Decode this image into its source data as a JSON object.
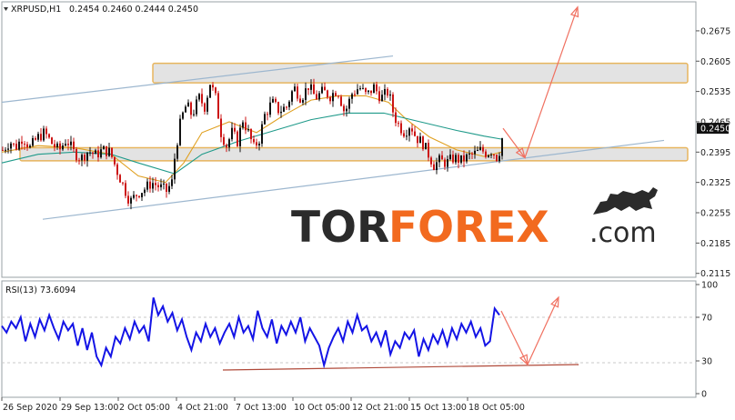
{
  "header": {
    "symbol_label": "XRPUSD,H1",
    "ohlc": "0.2454 0.2460 0.2444 0.2450"
  },
  "rsi_header": "RSI(13) 73.6094",
  "watermark": {
    "tor": "TOR",
    "forex": "FOREX",
    "dotcom": ".com"
  },
  "colors": {
    "candle_up": "#111111",
    "candle_down": "#cc1414",
    "ma_fast": "#e0a020",
    "ma_slow": "#1f9a8a",
    "channel": "#9db7cf",
    "zone_fill": "#d9d9d9",
    "zone_border": "#e8b55e",
    "arrow": "#f07060",
    "rsi_line": "#1414e6",
    "rsi_trend": "#b04a3a",
    "wm_dark": "#2b2b2b",
    "wm_orange": "#f26a1f",
    "price_tag_bg": "#111111"
  },
  "chart_data": [
    {
      "type": "candlestick",
      "title": "XRPUSD,H1",
      "price_labels": [
        "0.2675",
        "0.2605",
        "0.2535",
        "0.2465",
        "0.2450",
        "0.2395",
        "0.2325",
        "0.2255",
        "0.2185",
        "0.2115"
      ],
      "current_price": "0.2450",
      "ylim": [
        0.2106,
        0.2742
      ],
      "x_tick_labels": [
        "26 Sep 2020",
        "29 Sep 13:00",
        "2 Oct 05:00",
        "4 Oct 21:00",
        "7 Oct 13:00",
        "10 Oct 05:00",
        "12 Oct 21:00",
        "15 Oct 13:00",
        "18 Oct 05:00"
      ],
      "price_path": [
        [
          0,
          0.24
        ],
        [
          8,
          0.242
        ],
        [
          14,
          0.2405
        ],
        [
          22,
          0.243
        ],
        [
          30,
          0.2405
        ],
        [
          38,
          0.2428
        ],
        [
          46,
          0.244
        ],
        [
          54,
          0.2415
        ],
        [
          62,
          0.2398
        ],
        [
          70,
          0.2425
        ],
        [
          78,
          0.2395
        ],
        [
          86,
          0.238
        ],
        [
          94,
          0.2398
        ],
        [
          102,
          0.2388
        ],
        [
          110,
          0.24
        ],
        [
          118,
          0.2395
        ],
        [
          126,
          0.235
        ],
        [
          134,
          0.231
        ],
        [
          140,
          0.228
        ],
        [
          148,
          0.23
        ],
        [
          156,
          0.231
        ],
        [
          164,
          0.2325
        ],
        [
          172,
          0.2315
        ],
        [
          180,
          0.2305
        ],
        [
          186,
          0.2325
        ],
        [
          190,
          0.24
        ],
        [
          196,
          0.247
        ],
        [
          202,
          0.2505
        ],
        [
          208,
          0.248
        ],
        [
          216,
          0.252
        ],
        [
          222,
          0.25
        ],
        [
          228,
          0.2555
        ],
        [
          234,
          0.252
        ],
        [
          240,
          0.244
        ],
        [
          246,
          0.241
        ],
        [
          252,
          0.244
        ],
        [
          258,
          0.242
        ],
        [
          264,
          0.247
        ],
        [
          270,
          0.244
        ],
        [
          276,
          0.2405
        ],
        [
          282,
          0.2425
        ],
        [
          288,
          0.248
        ],
        [
          296,
          0.251
        ],
        [
          304,
          0.249
        ],
        [
          312,
          0.25
        ],
        [
          320,
          0.2545
        ],
        [
          328,
          0.252
        ],
        [
          336,
          0.2548
        ],
        [
          344,
          0.252
        ],
        [
          352,
          0.2535
        ],
        [
          360,
          0.2525
        ],
        [
          368,
          0.254
        ],
        [
          376,
          0.2485
        ],
        [
          384,
          0.253
        ],
        [
          392,
          0.2545
        ],
        [
          400,
          0.2525
        ],
        [
          408,
          0.2545
        ],
        [
          416,
          0.252
        ],
        [
          424,
          0.2535
        ],
        [
          430,
          0.248
        ],
        [
          436,
          0.2455
        ],
        [
          442,
          0.244
        ],
        [
          448,
          0.246
        ],
        [
          454,
          0.243
        ],
        [
          462,
          0.2415
        ],
        [
          468,
          0.239
        ],
        [
          474,
          0.2365
        ],
        [
          480,
          0.2375
        ],
        [
          488,
          0.237
        ],
        [
          496,
          0.2382
        ],
        [
          504,
          0.2375
        ],
        [
          512,
          0.2385
        ],
        [
          520,
          0.2392
        ],
        [
          526,
          0.24
        ],
        [
          532,
          0.2392
        ],
        [
          538,
          0.24
        ],
        [
          544,
          0.238
        ],
        [
          548,
          0.2415
        ],
        [
          551,
          0.245
        ]
      ],
      "ma_fast": [
        [
          0,
          0.2395
        ],
        [
          40,
          0.241
        ],
        [
          80,
          0.2405
        ],
        [
          120,
          0.239
        ],
        [
          150,
          0.234
        ],
        [
          180,
          0.2325
        ],
        [
          200,
          0.237
        ],
        [
          220,
          0.244
        ],
        [
          250,
          0.2465
        ],
        [
          280,
          0.244
        ],
        [
          310,
          0.248
        ],
        [
          340,
          0.2515
        ],
        [
          370,
          0.2525
        ],
        [
          400,
          0.2525
        ],
        [
          425,
          0.251
        ],
        [
          445,
          0.247
        ],
        [
          470,
          0.243
        ],
        [
          500,
          0.24
        ],
        [
          530,
          0.2385
        ],
        [
          549,
          0.2395
        ]
      ],
      "ma_slow": [
        [
          0,
          0.237
        ],
        [
          40,
          0.239
        ],
        [
          80,
          0.2395
        ],
        [
          120,
          0.239
        ],
        [
          150,
          0.237
        ],
        [
          190,
          0.2345
        ],
        [
          220,
          0.239
        ],
        [
          260,
          0.242
        ],
        [
          300,
          0.2445
        ],
        [
          340,
          0.247
        ],
        [
          380,
          0.2485
        ],
        [
          420,
          0.2485
        ],
        [
          460,
          0.2465
        ],
        [
          500,
          0.2445
        ],
        [
          530,
          0.2432
        ],
        [
          549,
          0.2425
        ]
      ],
      "resistance_zone": [
        0.2555,
        0.26
      ],
      "support_zone": [
        0.2375,
        0.2405
      ],
      "channel_upper": [
        [
          0,
          0.251
        ],
        [
          430,
          0.2617
        ]
      ],
      "channel_lower": [
        [
          45,
          0.224
        ],
        [
          728,
          0.2422
        ]
      ],
      "projection_arrows": [
        [
          [
            551,
            0.245
          ],
          [
            575,
            0.2382
          ]
        ],
        [
          [
            575,
            0.2382
          ],
          [
            633,
            0.273
          ]
        ]
      ]
    },
    {
      "type": "line",
      "title": "RSI(13) 73.6094",
      "ylim": [
        0,
        100
      ],
      "y_tick_labels": [
        "100",
        "70",
        "30",
        "0"
      ],
      "values": [
        62,
        56,
        66,
        60,
        70,
        48,
        64,
        52,
        68,
        58,
        72,
        60,
        50,
        66,
        58,
        64,
        44,
        60,
        40,
        56,
        34,
        26,
        42,
        34,
        52,
        46,
        60,
        50,
        66,
        56,
        62,
        48,
        88,
        72,
        80,
        66,
        74,
        58,
        68,
        52,
        40,
        56,
        48,
        64,
        52,
        60,
        46,
        56,
        64,
        52,
        70,
        56,
        62,
        50,
        76,
        60,
        52,
        68,
        46,
        62,
        54,
        66,
        56,
        70,
        48,
        60,
        52,
        44,
        26,
        42,
        52,
        60,
        48,
        66,
        56,
        72,
        58,
        62,
        48,
        56,
        44,
        58,
        36,
        48,
        42,
        56,
        50,
        58,
        34,
        50,
        40,
        54,
        46,
        58,
        44,
        60,
        50,
        64,
        56,
        66,
        52,
        60,
        44,
        48,
        78,
        72
      ]
    }
  ]
}
